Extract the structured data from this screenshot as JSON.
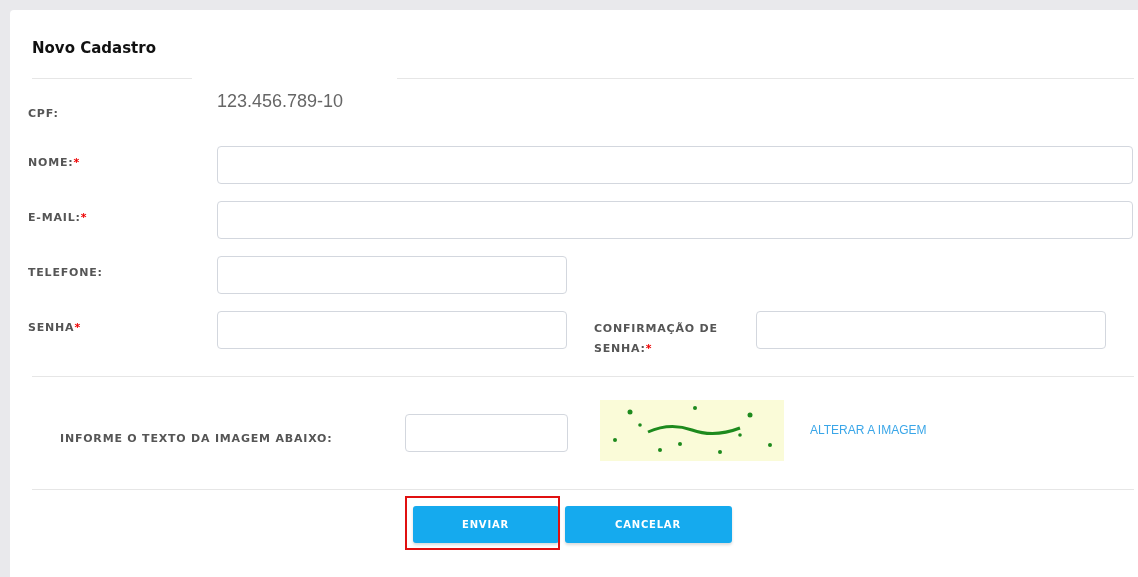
{
  "title": "Novo Cadastro",
  "rows": [
    {
      "kind": "static",
      "label": "CPF:",
      "value": "123.456.789-10"
    },
    {
      "kind": "wide",
      "label": "NOME:",
      "required_mark": "*"
    },
    {
      "kind": "wide",
      "label": "E-MAIL:",
      "required_mark": "*"
    },
    {
      "kind": "short",
      "label": "TELEFONE:"
    },
    {
      "kind": "pair",
      "fields": [
        {
          "label": "SENHA",
          "required_mark": "*"
        },
        {
          "label": "CONFIRMAÇÃO DE SENHA:",
          "required_mark": "*"
        }
      ]
    }
  ],
  "captcha": {
    "label": "INFORME O TEXTO DA IMAGEM ABAIXO:",
    "link": "ALTERAR A IMAGEM"
  },
  "buttons": [
    {
      "label": "ENVIAR",
      "highlighted": true
    },
    {
      "label": "CANCELAR",
      "highlighted": false
    }
  ]
}
